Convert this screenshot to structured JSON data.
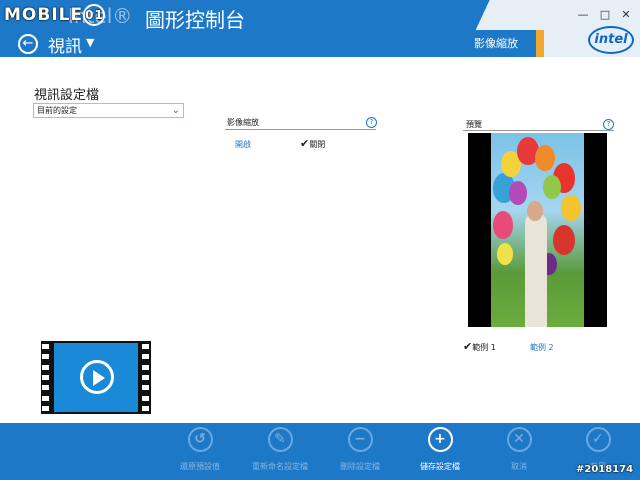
{
  "header": {
    "brand_text": "MOBILE",
    "brand_mark": "01",
    "title_prefix": "Intel®",
    "title": "圖形控制台",
    "back_icon": "arrow-left-icon",
    "section": "視訊",
    "tab_label": "影像縮放",
    "window_controls": [
      "—",
      "□",
      "✕"
    ],
    "logo_text": "intel",
    "bg_color": "#1e78c8",
    "accent_color": "#f0a830"
  },
  "left_panel": {
    "title": "視訊設定檔",
    "profile_value": "目前的設定",
    "video_icon": "video-play-icon"
  },
  "scaling": {
    "title": "影像縮放",
    "help": "?",
    "option_on": "開啟",
    "option_off": "關閉",
    "selected": "關閉"
  },
  "preview": {
    "title": "預覽",
    "help": "?",
    "example1": "範例 1",
    "example2": "範例 2",
    "selected": "範例 1"
  },
  "toolbar": {
    "buttons": [
      {
        "label": "還原預設值",
        "icon": "undo-icon",
        "glyph": "↺",
        "enabled": false
      },
      {
        "label": "重新命名設定檔",
        "icon": "pencil-icon",
        "glyph": "✎",
        "enabled": false
      },
      {
        "label": "刪除設定檔",
        "icon": "minus-icon",
        "glyph": "−",
        "enabled": false
      },
      {
        "label": "儲存設定檔",
        "icon": "plus-icon",
        "glyph": "+",
        "enabled": true
      },
      {
        "label": "取消",
        "icon": "close-icon",
        "glyph": "✕",
        "enabled": false
      },
      {
        "label": "套用",
        "icon": "check-icon",
        "glyph": "✓",
        "enabled": false
      }
    ]
  },
  "watermark": "#2018174"
}
